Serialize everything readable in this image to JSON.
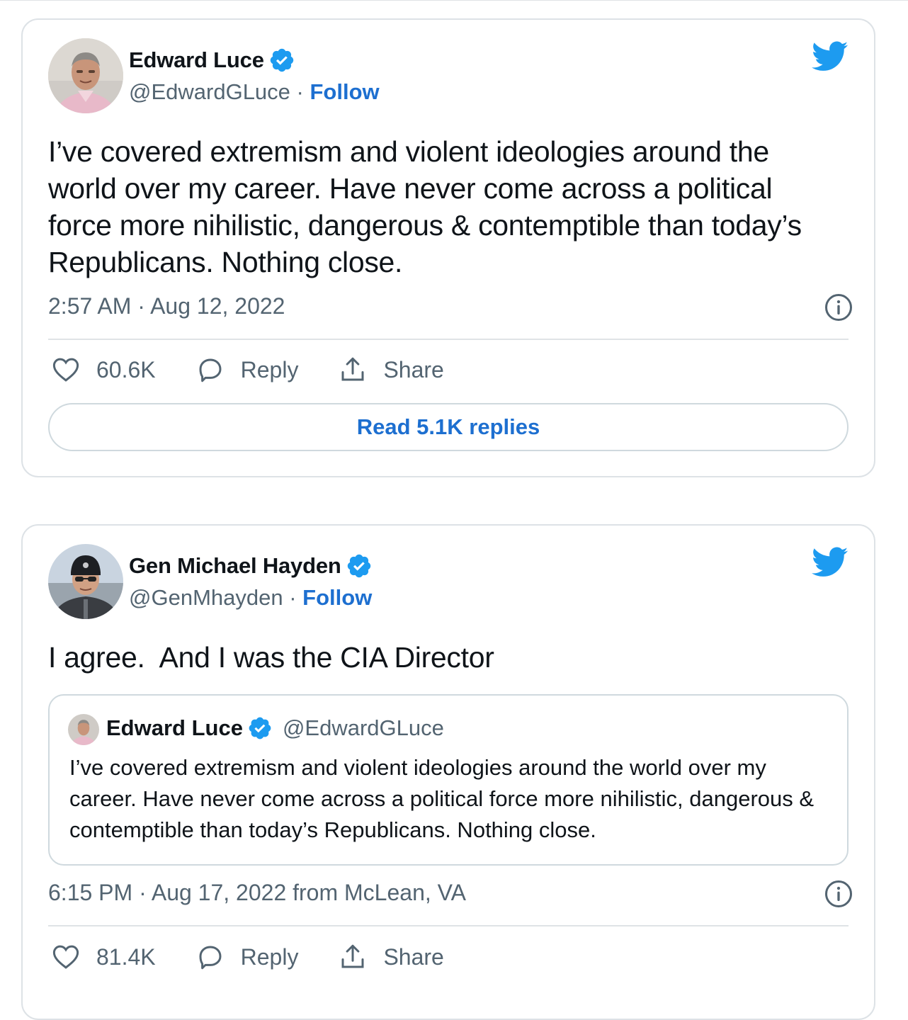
{
  "colors": {
    "accent": "#1d6fd0",
    "twitter_blue": "#1d9bf0",
    "muted": "#536471",
    "border": "#dde2e6"
  },
  "tweet1": {
    "author_name": "Edward Luce",
    "handle": "@EdwardGLuce",
    "separator": " · ",
    "follow_label": "Follow",
    "text": "I’ve covered extremism and violent ideologies around the world over my career. Have never come across a political force more nihilistic, dangerous & contemptible than today’s Republicans. Nothing close.",
    "timestamp": "2:57 AM · Aug 12, 2022",
    "likes": "60.6K",
    "reply_label": "Reply",
    "share_label": "Share",
    "read_replies_label": "Read 5.1K replies"
  },
  "tweet2": {
    "author_name": "Gen Michael Hayden",
    "handle": "@GenMhayden",
    "separator": " · ",
    "follow_label": "Follow",
    "text": "I agree.  And I was the CIA Director",
    "quoted": {
      "author_name": "Edward Luce",
      "handle": "@EdwardGLuce",
      "text": "I’ve covered extremism and violent ideologies around the world over my career. Have never come across a political force more nihilistic, dangerous & contemptible than today’s Republicans. Nothing close."
    },
    "timestamp": "6:15 PM · Aug 17, 2022 from McLean, VA",
    "likes": "81.4K",
    "reply_label": "Reply",
    "share_label": "Share"
  },
  "icons": [
    "verified-badge-icon",
    "twitter-bird-icon",
    "info-icon",
    "heart-icon",
    "reply-icon",
    "share-icon"
  ]
}
